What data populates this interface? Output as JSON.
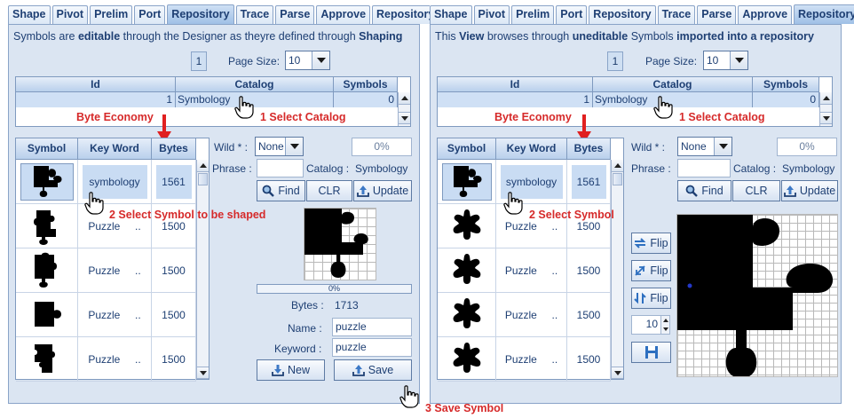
{
  "tabs": [
    "Shape",
    "Pivot",
    "Prelim",
    "Port",
    "Repository",
    "Trace",
    "Parse",
    "Approve",
    "Repository"
  ],
  "left": {
    "active_tab": 4,
    "description_parts": [
      "Symbols are ",
      "editable",
      " through the Designer as theyre defined through ",
      "Shaping"
    ],
    "page": "1",
    "page_size_label": "Page Size:",
    "page_size": "10",
    "catalog_table": {
      "headers": [
        "Id",
        "Catalog",
        "Symbols"
      ],
      "row": {
        "id": "1",
        "catalog": "Symbology",
        "symbols": "0"
      }
    },
    "note_byte_economy": "Byte Economy",
    "note_select_catalog": "1 Select Catalog",
    "note_select_symbol": "2 Select Symbol to be shaped",
    "symbol_table": {
      "headers": [
        "Symbol",
        "Key Word",
        "Bytes"
      ],
      "rows": [
        {
          "keyword": "symbology",
          "bytes": "1561"
        },
        {
          "keyword": "Puzzle     ..",
          "bytes": "1500"
        },
        {
          "keyword": "Puzzle     ..",
          "bytes": "1500"
        },
        {
          "keyword": "Puzzle     ..",
          "bytes": "1500"
        },
        {
          "keyword": "Puzzle     ..",
          "bytes": "1500"
        }
      ]
    },
    "wild_label": "Wild  * :",
    "wild_value": "None",
    "wild_pct": "0%",
    "phrase_label": "Phrase :",
    "catalog_label": "Catalog :",
    "catalog_value": "Symbology",
    "find": "Find",
    "clr": "CLR",
    "update": "Update",
    "progress": "0%",
    "bytes_label": "Bytes :",
    "bytes_value": "1713",
    "name_label": "Name :",
    "name_value": "puzzle",
    "keyword_label": "Keyword :",
    "keyword_value": "puzzle",
    "new": "New",
    "save": "Save"
  },
  "right": {
    "active_tab": 8,
    "description_parts": [
      "This ",
      "View",
      " browses through ",
      "uneditable",
      " Symbols ",
      "imported into a repository"
    ],
    "page": "1",
    "page_size_label": "Page Size:",
    "page_size": "10",
    "catalog_table": {
      "headers": [
        "Id",
        "Catalog",
        "Symbols"
      ],
      "row": {
        "id": "1",
        "catalog": "Symbology",
        "symbols": "0"
      }
    },
    "note_byte_economy": "Byte Economy",
    "note_select_catalog": "1 Select Catalog",
    "note_select_symbol": "2 Select Symbol",
    "symbol_table": {
      "headers": [
        "Symbol",
        "Key Word",
        "Bytes"
      ],
      "rows": [
        {
          "keyword": "symbology",
          "bytes": "1561"
        },
        {
          "keyword": "Puzzle     ..",
          "bytes": "1500"
        },
        {
          "keyword": "Puzzle     ..",
          "bytes": "1500"
        },
        {
          "keyword": "Puzzle     ..",
          "bytes": "1500"
        },
        {
          "keyword": "Puzzle     ..",
          "bytes": "1500"
        }
      ]
    },
    "wild_label": "Wild  * :",
    "wild_value": "None",
    "wild_pct": "0%",
    "phrase_label": "Phrase :",
    "catalog_label": "Catalog :",
    "catalog_value": "Symbology",
    "find": "Find",
    "clr": "CLR",
    "update": "Update",
    "flip1": "Flip",
    "flip2": "Flip",
    "flip3": "Flip",
    "spinner": "10"
  },
  "note_save_symbol": "3 Save Symbol",
  "colors": {
    "panel_bg": "#dbe5f2",
    "accent_text": "#1e3f73",
    "annotation_red": "#d62a2a",
    "selection": "#c9dcf3"
  }
}
